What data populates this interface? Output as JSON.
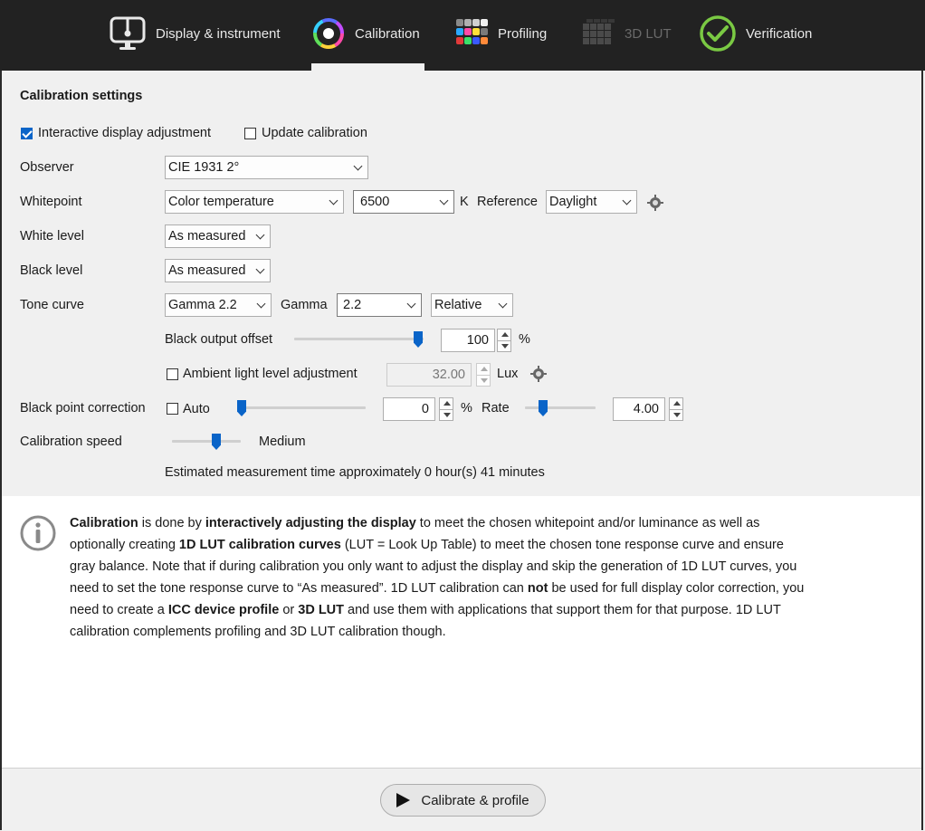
{
  "tabs": [
    {
      "label": "Display & instrument",
      "state": "normal"
    },
    {
      "label": "Calibration",
      "state": "active"
    },
    {
      "label": "Profiling",
      "state": "normal"
    },
    {
      "label": "3D LUT",
      "state": "disabled"
    },
    {
      "label": "Verification",
      "state": "normal"
    }
  ],
  "colors": {
    "accent": "#0a64c8",
    "verify_green": "#7ac943",
    "topbar": "#222222"
  },
  "settings": {
    "title": "Calibration settings",
    "interactive_adjustment": {
      "label": "Interactive display adjustment",
      "checked": true
    },
    "update_calibration": {
      "label": "Update calibration",
      "checked": false
    },
    "observer": {
      "label": "Observer",
      "value": "CIE 1931 2°"
    },
    "whitepoint": {
      "label": "Whitepoint",
      "mode": "Color temperature",
      "temperature": "6500",
      "unit": "K",
      "reference_label": "Reference",
      "reference": "Daylight"
    },
    "white_level": {
      "label": "White level",
      "value": "As measured"
    },
    "black_level": {
      "label": "Black level",
      "value": "As measured"
    },
    "tone_curve": {
      "label": "Tone curve",
      "value": "Gamma 2.2",
      "gamma_label": "Gamma",
      "gamma": "2.2",
      "type": "Relative"
    },
    "black_output_offset": {
      "label": "Black output offset",
      "value": "100",
      "unit": "%",
      "level": 1.0
    },
    "ambient": {
      "label": "Ambient light level adjustment",
      "checked": false,
      "value": "32.00",
      "unit": "Lux"
    },
    "black_point_correction": {
      "label": "Black point correction",
      "auto_label": "Auto",
      "auto_checked": false,
      "value": "0",
      "unit": "%",
      "level": 0.0,
      "rate_label": "Rate",
      "rate": "4.00",
      "rate_level": 0.2
    },
    "calibration_speed": {
      "label": "Calibration speed",
      "value": "Medium",
      "level": 0.6
    },
    "estimate": "Estimated measurement time approximately 0 hour(s) 41 minutes"
  },
  "info": {
    "p1": "Calibration",
    "p2": " is done by ",
    "p3": "interactively adjusting the display",
    "p4": " to meet the chosen whitepoint and/or luminance as well as optionally creating ",
    "p5": "1D LUT calibration curves",
    "p6": " (LUT = Look Up Table) to meet the chosen tone response curve and ensure gray balance. Note that if during calibration you only want to adjust the display and skip the generation of 1D LUT curves, you need to set the tone response curve to “As measured”. 1D LUT calibration can ",
    "p7": "not",
    "p8": " be used for full display color correction, you need to create a ",
    "p9": "ICC device profile",
    "p10": " or ",
    "p11": "3D LUT",
    "p12": " and use them with applications that support them for that purpose. 1D LUT calibration complements profiling and 3D LUT calibration though."
  },
  "footer": {
    "button": "Calibrate & profile"
  }
}
